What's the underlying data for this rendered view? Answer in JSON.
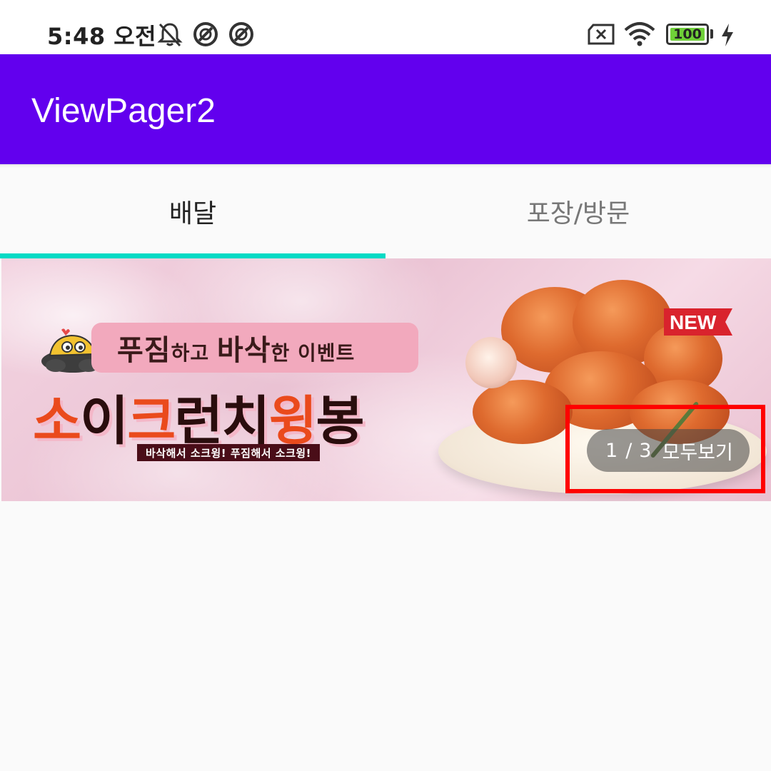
{
  "status_bar": {
    "time": "5:48 오전",
    "battery_level": "100",
    "icons": [
      "notifications-off-icon",
      "app-notification-icon",
      "app-notification-icon",
      "no-sim-icon",
      "wifi-icon",
      "battery-icon",
      "charging-icon"
    ]
  },
  "app_bar": {
    "title": "ViewPager2",
    "color": "#6200ee"
  },
  "tabs": [
    {
      "label": "배달",
      "selected": true
    },
    {
      "label": "포장/방문",
      "selected": false
    }
  ],
  "tab_indicator_color": "#03dac5",
  "banner": {
    "headline_a": "푸짐",
    "headline_b": "하고 ",
    "headline_c": "바삭",
    "headline_d": "한 이벤트",
    "title_1": "소",
    "title_2": "이",
    "title_3": "크",
    "title_4": "런치",
    "title_5": "윙",
    "title_6": "봉",
    "subtitle": "바삭해서 소크윙! 푸짐해서 소크윙!",
    "badge": "NEW",
    "page_current": "1",
    "page_separator": "/",
    "page_total": "3",
    "view_all": "모두보기"
  },
  "highlight_color": "#ff0000"
}
